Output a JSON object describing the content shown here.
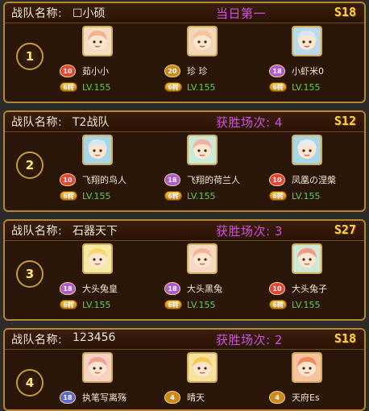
{
  "labels": {
    "team_label": "战队名称:",
    "level_prefix": "LV.",
    "star_text": "6转"
  },
  "cards": [
    {
      "rank": "1",
      "team_name": "☐小硕",
      "result": "当日第一",
      "server": "S18",
      "members": [
        {
          "name": "茹小小",
          "badge": "10",
          "badge_color": "#e0463a",
          "level": "LV.155",
          "hair": "#f6b28c",
          "bg": "#f7dcc4"
        },
        {
          "name": "珍 珍",
          "badge": "20",
          "badge_color": "#c98a1f",
          "level": "LV.155",
          "hair": "#f5c49d",
          "bg": "#f2d7b8"
        },
        {
          "name": "小虾米0",
          "badge": "18",
          "badge_color": "#b05ad2",
          "level": "LV.155",
          "hair": "#d8e8f2",
          "bg": "#bcd9ea"
        }
      ]
    },
    {
      "rank": "2",
      "team_name": "T2战队",
      "result": "获胜场次: 4",
      "server": "S12",
      "members": [
        {
          "name": "飞翔的鸟人",
          "badge": "10",
          "badge_color": "#e0463a",
          "level": "LV.155",
          "hair": "#d2e9f2",
          "bg": "#a8d6e6"
        },
        {
          "name": "飞翔的荷兰人",
          "badge": "18",
          "badge_color": "#b05ad2",
          "level": "LV.155",
          "hair": "#f4b0a0",
          "bg": "#c9e9d9"
        },
        {
          "name": "凤凰の涅槃",
          "badge": "10",
          "badge_color": "#e0463a",
          "level": "LV.155",
          "hair": "#e2eef5",
          "bg": "#a8d6e6"
        }
      ]
    },
    {
      "rank": "3",
      "team_name": "石器天下",
      "result": "获胜场次: 3",
      "server": "S27",
      "members": [
        {
          "name": "大头兔皇",
          "badge": "18",
          "badge_color": "#b05ad2",
          "level": "LV.155",
          "hair": "#f7d96a",
          "bg": "#f5e9a8"
        },
        {
          "name": "大头黑兔",
          "badge": "18",
          "badge_color": "#b05ad2",
          "level": "LV.155",
          "hair": "#f3b896",
          "bg": "#f5d9c2"
        },
        {
          "name": "大头兔子",
          "badge": "10",
          "badge_color": "#e0463a",
          "level": "LV.155",
          "hair": "#f19a8a",
          "bg": "#cfe8d6"
        }
      ]
    },
    {
      "rank": "4",
      "team_name": "123456",
      "result": "获胜场次: 2",
      "server": "S18",
      "members": [
        {
          "name": "执笔写离殇",
          "badge": "18",
          "badge_color": "#5a6ad2",
          "level": "",
          "hair": "#f2a090",
          "bg": "#f6d2c4"
        },
        {
          "name": "晴天",
          "badge": "4",
          "badge_color": "#c98a1f",
          "level": "",
          "hair": "#f7c94a",
          "bg": "#f6e2a0"
        },
        {
          "name": "天府Es",
          "badge": "4",
          "badge_color": "#c98a1f",
          "level": "",
          "hair": "#f08a5a",
          "bg": "#f6c2a0"
        }
      ]
    }
  ]
}
